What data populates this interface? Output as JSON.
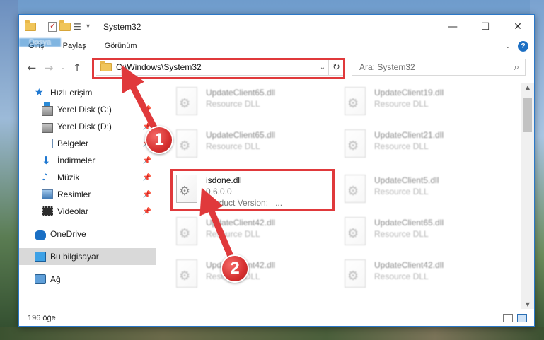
{
  "window": {
    "title": "System32",
    "controls": {
      "minimize": "—",
      "maximize": "☐",
      "close": "✕"
    }
  },
  "ribbon": {
    "tabs": [
      "Dosya",
      "Giriş",
      "Paylaş",
      "Görünüm"
    ]
  },
  "address_bar": {
    "path": "C:\\Windows\\System32"
  },
  "search": {
    "placeholder": "Ara: System32"
  },
  "sidebar": {
    "items": [
      {
        "label": "Hızlı erişim",
        "icon": "star-icon"
      },
      {
        "label": "Yerel Disk (C:)",
        "icon": "drive-icon",
        "pinned": true
      },
      {
        "label": "Yerel Disk (D:)",
        "icon": "drive-icon",
        "pinned": true
      },
      {
        "label": "Belgeler",
        "icon": "document-icon",
        "pinned": true
      },
      {
        "label": "İndirmeler",
        "icon": "download-icon",
        "pinned": true
      },
      {
        "label": "Müzik",
        "icon": "music-icon",
        "pinned": true
      },
      {
        "label": "Resimler",
        "icon": "pictures-icon",
        "pinned": true
      },
      {
        "label": "Videolar",
        "icon": "videos-icon",
        "pinned": true
      },
      {
        "label": "OneDrive",
        "icon": "cloud-icon"
      },
      {
        "label": "Bu bilgisayar",
        "icon": "computer-icon",
        "selected": true
      },
      {
        "label": "Ağ",
        "icon": "network-icon"
      }
    ]
  },
  "files": [
    {
      "name": "UpdateClient65.dll",
      "desc": "Resource DLL"
    },
    {
      "name": "UpdateClient19.dll",
      "desc": "Resource DLL"
    },
    {
      "name": "UpdateClient65.dll",
      "desc": "Resource DLL"
    },
    {
      "name": "UpdateClient21.dll",
      "desc": "Resource DLL"
    },
    {
      "name": "isdone.dll",
      "version": "0.6.0.0",
      "product": "Product Version:",
      "product_value": "..."
    },
    {
      "name": "UpdateClient5.dll",
      "desc": "Resource DLL"
    },
    {
      "name": "UpdateClient42.dll",
      "desc": "Resource DLL"
    },
    {
      "name": "UpdateClient65.dll",
      "desc": "Resource DLL"
    },
    {
      "name": "UpdateClient42.dll",
      "desc": "Resource DLL"
    },
    {
      "name": "UpdateClient42.dll",
      "desc": "Resource DLL"
    }
  ],
  "status": {
    "count": "196 öğe"
  },
  "callouts": [
    "1",
    "2"
  ],
  "colors": {
    "accent": "#1979ca",
    "highlight": "#e0393b"
  }
}
